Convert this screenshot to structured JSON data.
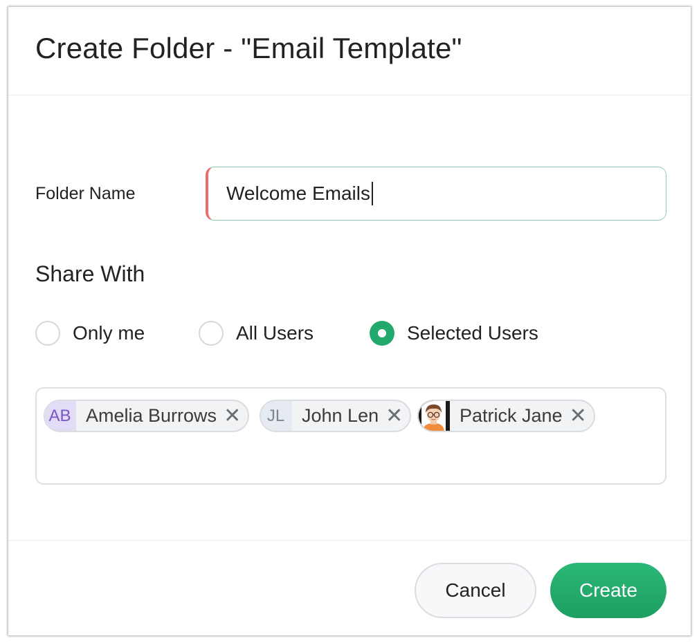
{
  "dialog": {
    "title": "Create Folder - \"Email Template\""
  },
  "form": {
    "folder_name_label": "Folder Name",
    "folder_name_value": "Welcome Emails",
    "share_heading": "Share With",
    "share_options": [
      {
        "label": "Only me",
        "selected": false
      },
      {
        "label": "All Users",
        "selected": false
      },
      {
        "label": "Selected Users",
        "selected": true
      }
    ],
    "selected_users": [
      {
        "initials": "AB",
        "name": "Amelia Burrows",
        "avatar_bg": "#e3dcf6",
        "avatar_color": "#7757c4"
      },
      {
        "initials": "JL",
        "name": "John Len",
        "avatar_bg": "#e6ebf1",
        "avatar_color": "#7a8494"
      },
      {
        "initials": "",
        "name": "Patrick Jane",
        "avatar_type": "photo-icon"
      }
    ],
    "remove_glyph": "✕"
  },
  "buttons": {
    "cancel": "Cancel",
    "create": "Create"
  },
  "colors": {
    "accent": "#23a86c",
    "required_indicator": "#f06c6c"
  }
}
